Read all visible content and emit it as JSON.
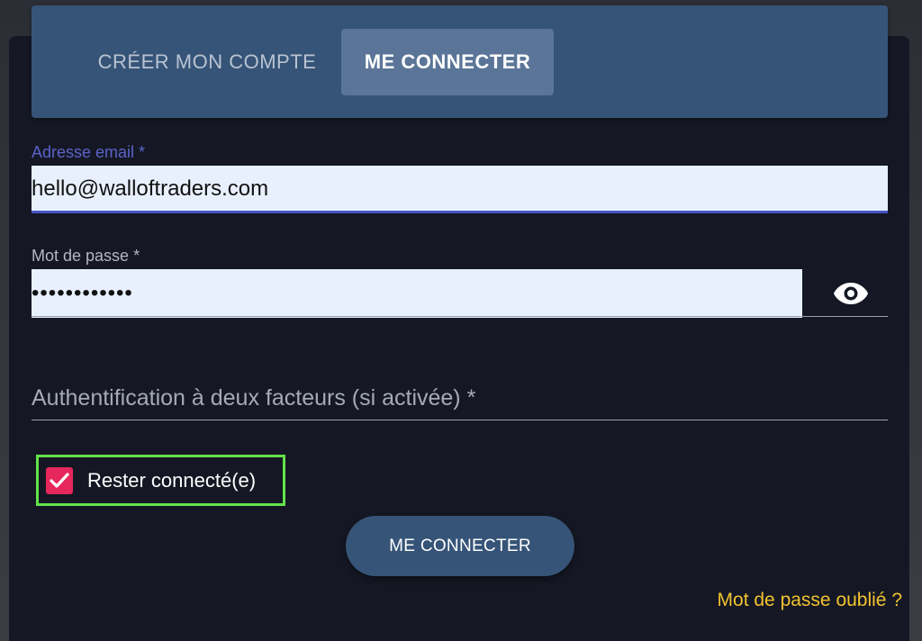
{
  "tabs": {
    "create_label": "CRÉER MON COMPTE",
    "login_label": "ME CONNECTER",
    "active": "login"
  },
  "form": {
    "email": {
      "label": "Adresse email *",
      "value": "hello@walloftraders.com"
    },
    "password": {
      "label": "Mot de passe *",
      "value": "••••••••••••",
      "toggle_icon": "eye-icon"
    },
    "twofa": {
      "placeholder": "Authentification à deux facteurs (si activée) *",
      "value": ""
    },
    "remember": {
      "label": "Rester connecté(e)",
      "checked": true
    },
    "submit_label": "ME CONNECTER",
    "forgot_label": "Mot de passe oublié ?"
  },
  "colors": {
    "accent_blue": "#365477",
    "focus_label": "#5a63c9",
    "checkbox": "#e5275c",
    "highlight_border": "#62e34a",
    "link": "#f2c230"
  }
}
